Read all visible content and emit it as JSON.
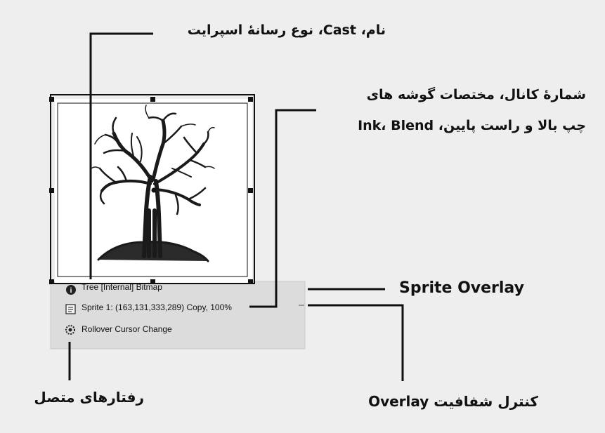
{
  "sprite": {
    "info_line1": "Tree [Internal] Bitmap",
    "info_line2": "Sprite 1: (163,131,333,289) Copy, 100%",
    "info_line3": "Rollover Cursor Change"
  },
  "callouts": {
    "name_cast": "نام، Cast، نوع رسانۀ اسپرایت",
    "channel_line1": "شمارۀ کانال، مختصات گوشه های",
    "channel_line2": "چپ بالا و راست پایین، Ink، Blend",
    "sprite_overlay": "Sprite Overlay",
    "overlay_transparency": "کنترل شفافیت Overlay",
    "behaviors": "رفتارهای متصل"
  },
  "icons": {
    "info_icon": "info-circle-icon",
    "sprite_icon": "sprite-properties-icon",
    "behavior_icon": "behavior-gear-icon"
  },
  "colors": {
    "background": "#eeeeee",
    "overlay_panel": "#dcdcdc",
    "lines": "#111111"
  }
}
